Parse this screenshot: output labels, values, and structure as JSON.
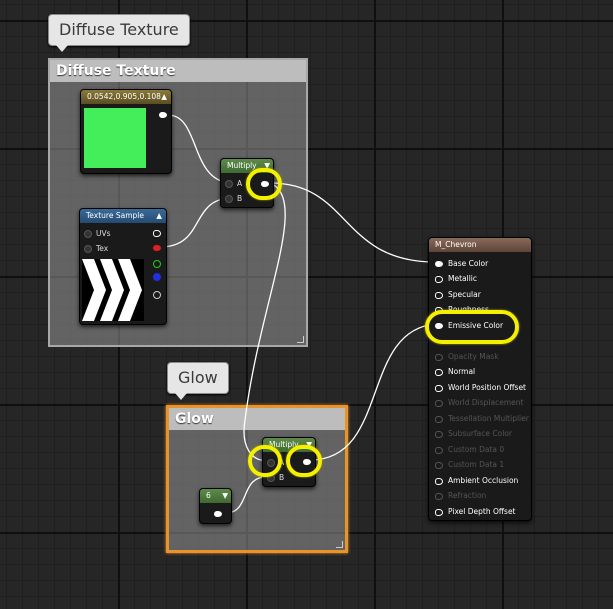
{
  "comments": {
    "diffuse": {
      "bubble": "Diffuse Texture",
      "title": "Diffuse Texture"
    },
    "glow": {
      "bubble": "Glow",
      "title": "Glow"
    }
  },
  "nodes": {
    "color_constant": {
      "title": "0.0542,0.905,0.108",
      "swatch_color": "#44ee5a"
    },
    "texture_sample": {
      "title": "Texture Sample",
      "pins": [
        "UVs",
        "Tex"
      ]
    },
    "multiply_top": {
      "title": "Multiply",
      "inputs": [
        "A",
        "B"
      ]
    },
    "multiply_glow": {
      "title": "Multiply",
      "inputs": [
        "A",
        "B"
      ]
    },
    "scalar": {
      "title": "6"
    }
  },
  "material": {
    "title": "M_Chevron",
    "pins": [
      "Base Color",
      "Metallic",
      "Specular",
      "Roughness",
      "Emissive Color",
      "Opacity Mask",
      "Normal",
      "World Position Offset",
      "World Displacement",
      "Tessellation Multiplier",
      "Subsurface Color",
      "Custom Data 0",
      "Custom Data 1",
      "Ambient Occlusion",
      "Refraction",
      "Pixel Depth Offset"
    ]
  },
  "colors": {
    "highlight": "#f5f000",
    "glow_border": "#e8942b",
    "wire": "#ffffff"
  }
}
